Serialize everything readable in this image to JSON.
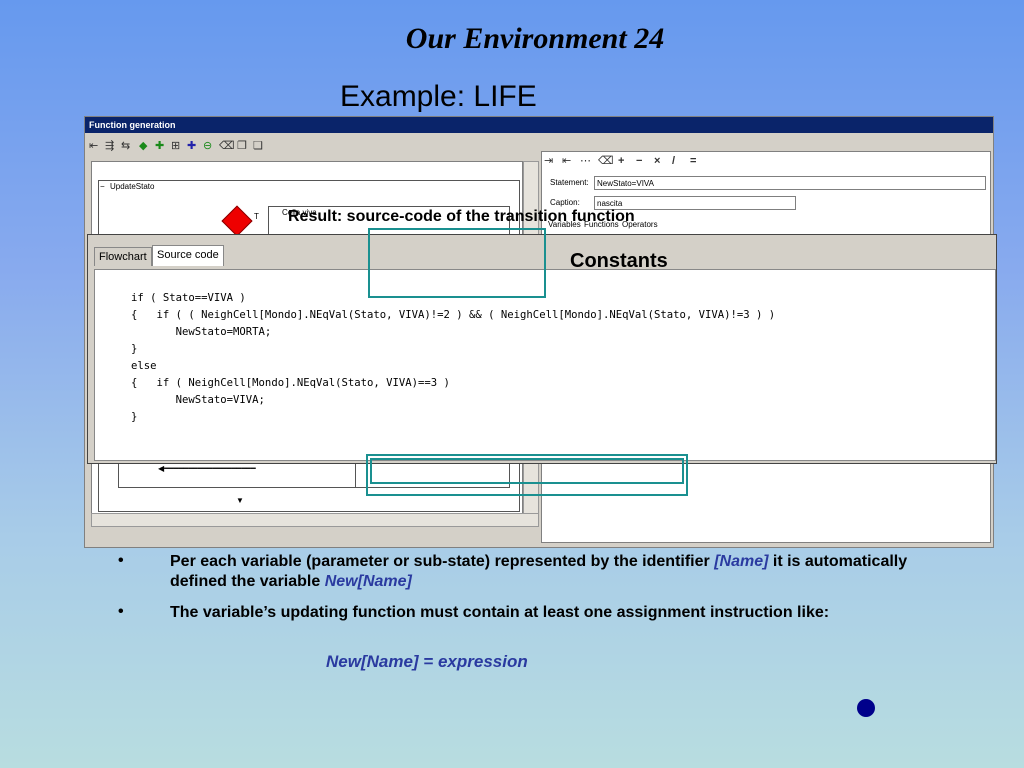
{
  "slide": {
    "title": "Our Environment 24",
    "subtitle": "Example: LIFE"
  },
  "window": {
    "title": "Function generation",
    "flowchart": {
      "root_label": "UpdateStato",
      "branch_label": "T",
      "inner_label": "Cella viva"
    },
    "properties": {
      "operators": [
        "+",
        "−",
        "×",
        "/",
        "="
      ],
      "statement_label": "Statement:",
      "statement_value": "NewStato=VIVA",
      "caption_label": "Caption:",
      "caption_value": "nascita",
      "tabs": [
        "Variables",
        "Functions",
        "Operators"
      ]
    }
  },
  "source_panel": {
    "tabs": [
      "Flowchart",
      "Source code"
    ],
    "active_tab": "Source code",
    "code": "if ( Stato==VIVA )\n{   if ( ( NeighCell[Mondo].NEqVal(Stato, VIVA)!=2 ) && ( NeighCell[Mondo].NEqVal(Stato, VIVA)!=3 ) )\n       NewStato=MORTA;\n}\nelse\n{   if ( NeighCell[Mondo].NEqVal(Stato, VIVA)==3 )\n       NewStato=VIVA;\n}"
  },
  "annotations": {
    "result": "Result: source-code of the transition function",
    "constants": "Constants",
    "accent_color": "#1a9090"
  },
  "bullets": [
    {
      "marker": "•",
      "part1": "Per each variable (parameter or sub-state) represented by the identifier ",
      "name": "[Name]",
      "part2": " it is automatically defined the variable ",
      "newname": "New[Name]"
    },
    {
      "marker": "•",
      "text": "The variable’s updating function must contain at least one assignment instruction like:"
    }
  ],
  "formula": "New[Name] = expression"
}
